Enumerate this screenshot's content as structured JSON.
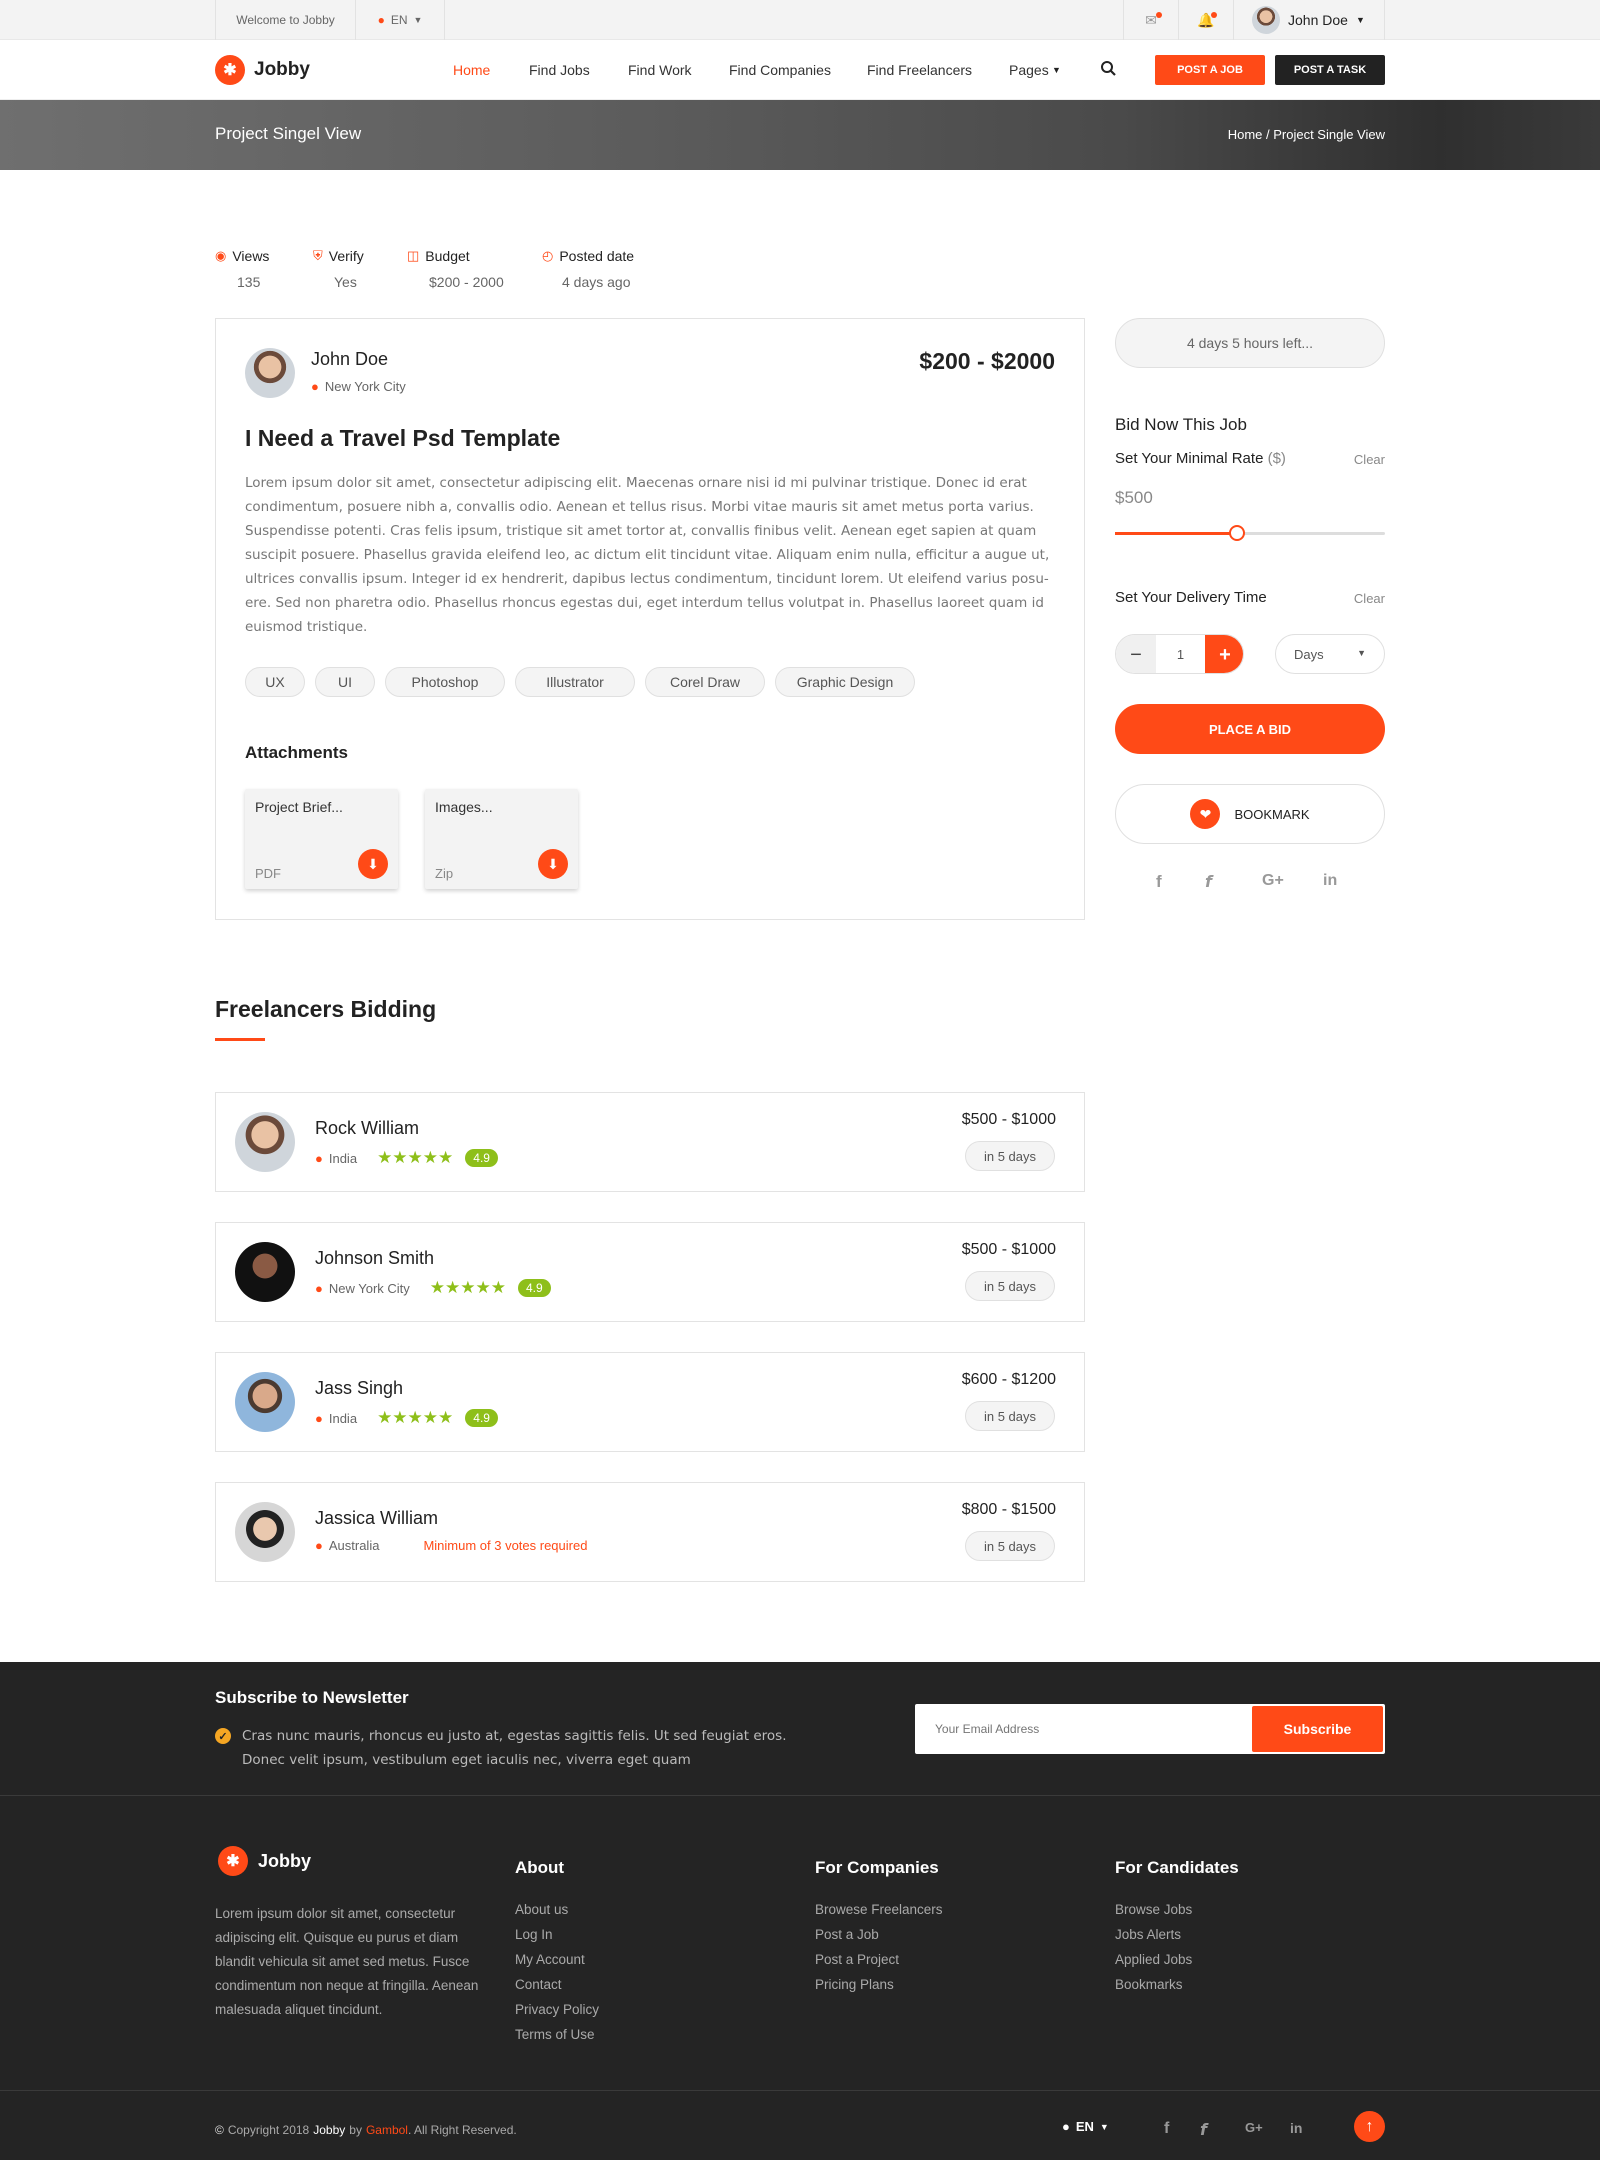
{
  "topbar": {
    "welcome": "Welcome to Jobby",
    "lang": "EN",
    "user_name": "John Doe"
  },
  "header": {
    "logo": "Jobby",
    "nav": [
      "Home",
      "Find Jobs",
      "Find Work",
      "Find Companies",
      "Find Freelancers",
      "Pages"
    ],
    "post_job": "POST A JOB",
    "post_task": "POST A TASK"
  },
  "banner": {
    "title": "Project Singel View",
    "breadcrumb": "Home / Project Single View"
  },
  "stats": [
    {
      "label": "Views",
      "value": "135",
      "icon": "eye-icon"
    },
    {
      "label": "Verify",
      "value": "Yes",
      "icon": "shield-icon"
    },
    {
      "label": "Budget",
      "value": "$200 - 2000",
      "icon": "money-icon"
    },
    {
      "label": "Posted date",
      "value": "4 days ago",
      "icon": "clock-icon"
    }
  ],
  "project": {
    "owner": "John Doe",
    "location": "New York City",
    "budget": "$200 - $2000",
    "title": "I Need a Travel Psd Template",
    "description": "Lorem ipsum dolor sit amet, consectetur adipiscing elit. Maecenas ornare nisi id mi pulvinar tristique. Donec id erat condimentum, posuere nibh a, convallis odio. Aenean et tellus risus. Morbi vitae mauris sit amet metus porta varius. Suspendisse potenti. Cras felis ipsum, tristique sit amet tortor at, convallis finibus velit. Aenean eget sapien at quam suscipit posuere. Phasellus gravida eleifend leo, ac dictum elit tincidunt vitae. Aliquam enim nulla, efficitur a augue ut, ultrices convallis ipsum. Integer id ex hendrerit, dapibus lectus condimentum, tincidunt lorem. Ut eleifend varius posu-ere. Sed non pharetra odio. Phasellus rhoncus egestas dui, eget interdum tellus volutpat in. Phasellus laoreet quam id euismod tristique.",
    "tags": [
      "UX",
      "UI",
      "Photoshop",
      "Illustrator",
      "Corel Draw",
      "Graphic Design"
    ],
    "attachments_title": "Attachments",
    "attachments": [
      {
        "name": "Project Brief...",
        "type": "PDF"
      },
      {
        "name": "Images...",
        "type": "Zip"
      }
    ]
  },
  "sidebar": {
    "time_left": "4 days 5 hours left...",
    "bid_title": "Bid Now This Job",
    "rate_label": "Set Your Minimal Rate",
    "rate_unit": "($)",
    "clear": "Clear",
    "rate_value": "$500",
    "rate_slider_fraction": 0.45,
    "delivery_label": "Set Your Delivery Time",
    "qty": "1",
    "unit_select": "Days",
    "place_bid": "PLACE A BID",
    "bookmark": "BOOKMARK"
  },
  "bidding": {
    "title": "Freelancers Bidding",
    "bidders": [
      {
        "name": "Rock William",
        "location": "India",
        "rating": "4.9",
        "price": "$500 - $1000",
        "days": "in 5 days",
        "note": ""
      },
      {
        "name": "Johnson Smith",
        "location": "New York City",
        "rating": "4.9",
        "price": "$500 - $1000",
        "days": "in 5 days",
        "note": ""
      },
      {
        "name": "Jass Singh",
        "location": "India",
        "rating": "4.9",
        "price": "$600 - $1200",
        "days": "in 5 days",
        "note": ""
      },
      {
        "name": "Jassica William",
        "location": "Australia",
        "rating": "",
        "price": "$800 - $1500",
        "days": "in 5 days",
        "note": "Minimum of 3 votes required"
      }
    ]
  },
  "newsletter": {
    "title": "Subscribe to Newsletter",
    "text_line1": "Cras nunc mauris, rhoncus eu justo at, egestas sagittis felis. Ut sed feugiat eros.",
    "text_line2": "Donec velit ipsum, vestibulum eget iaculis nec, viverra eget quam",
    "placeholder": "Your Email Address",
    "button": "Subscribe"
  },
  "footer": {
    "logo": "Jobby",
    "about_text": "Lorem ipsum dolor sit amet, consectetur adipiscing elit. Quisque eu purus et diam blandit vehicula sit amet sed metus. Fusce condimentum non neque at fringilla. Aenean malesuada aliquet tincidunt.",
    "about": {
      "title": "About",
      "links": [
        "About us",
        "Log In",
        "My Account",
        "Contact",
        "Privacy Policy",
        "Terms of Use"
      ]
    },
    "companies": {
      "title": "For Companies",
      "links": [
        "Browese Freelancers",
        "Post a Job",
        "Post a Project",
        "Pricing Plans"
      ]
    },
    "candidates": {
      "title": "For Candidates",
      "links": [
        "Browse Jobs",
        "Jobs Alerts",
        "Applied Jobs",
        "Bookmarks"
      ]
    },
    "copyright_pre": "Copyright 2018",
    "copyright_brand": "Jobby",
    "copyright_by": "by",
    "copyright_author": "Gambol",
    "copyright_post": ". All Right Reserved.",
    "lang": "EN"
  },
  "colors": {
    "accent": "#ff4a17",
    "rating": "#8ebf1a",
    "footer_bg": "#242424"
  }
}
